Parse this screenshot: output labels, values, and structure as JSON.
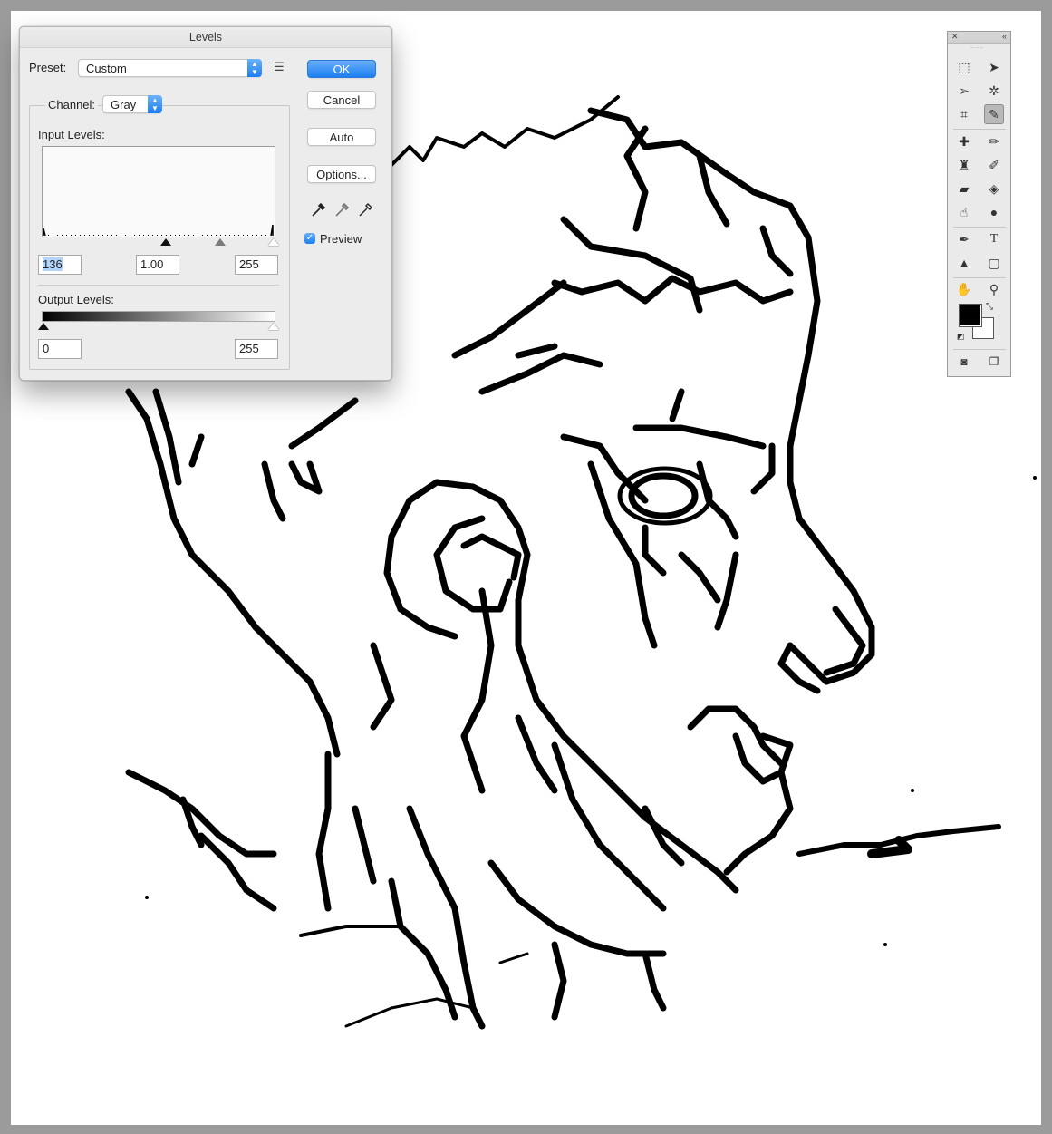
{
  "levels_dialog": {
    "title": "Levels",
    "preset_label": "Preset:",
    "preset_value": "Custom",
    "channel_label": "Channel:",
    "channel_value": "Gray",
    "input_levels_label": "Input Levels:",
    "input_black": "136",
    "input_gamma": "1.00",
    "input_white": "255",
    "output_levels_label": "Output Levels:",
    "output_black": "0",
    "output_white": "255",
    "buttons": {
      "ok": "OK",
      "cancel": "Cancel",
      "auto": "Auto",
      "options": "Options..."
    },
    "preview_label": "Preview",
    "preview_checked": true
  },
  "tools_panel": {
    "tools": [
      "marquee-icon",
      "move-icon",
      "lasso-icon",
      "magic-wand-icon",
      "crop-icon",
      "eyedropper-icon",
      "healing-brush-icon",
      "brush-icon",
      "clone-stamp-icon",
      "history-brush-icon",
      "eraser-icon",
      "paint-bucket-icon",
      "smudge-icon",
      "dodge-icon",
      "pen-icon",
      "type-icon",
      "path-select-icon",
      "shape-icon",
      "hand-icon",
      "zoom-icon"
    ],
    "active_tool": "eyedropper-icon",
    "foreground_color": "#000000",
    "background_color": "#ffffff"
  },
  "document": {
    "canvas_color": "#ffffff",
    "pasteboard_color": "#9b9b9b"
  }
}
